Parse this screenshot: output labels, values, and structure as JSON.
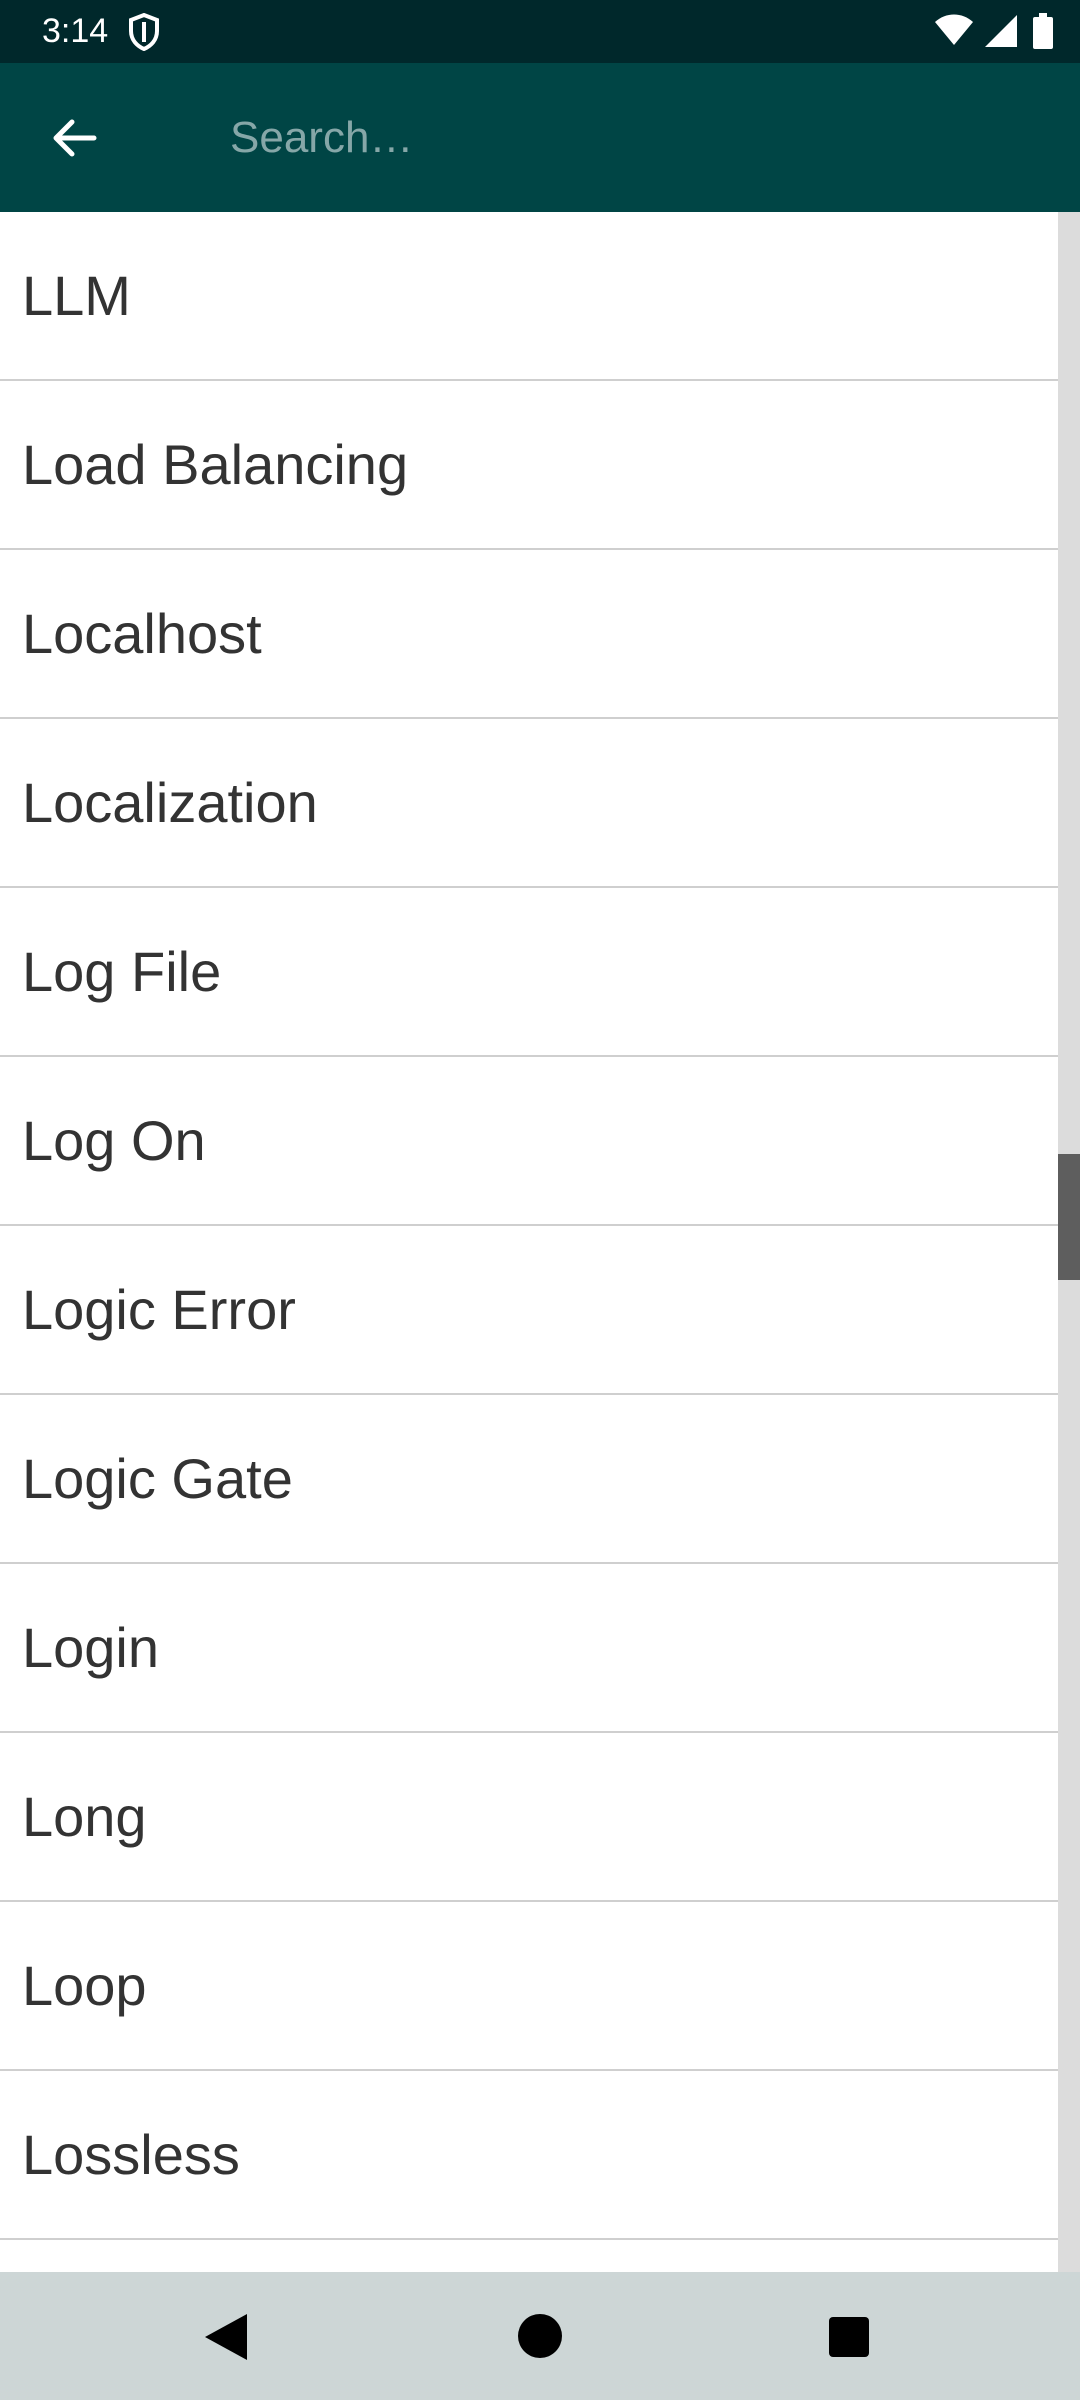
{
  "status_bar": {
    "time": "3:14",
    "icons": [
      "shield-icon",
      "wifi-icon",
      "signal-icon",
      "battery-icon"
    ]
  },
  "app_bar": {
    "back_icon": "arrow-left-icon",
    "search": {
      "placeholder": "Search…",
      "value": ""
    }
  },
  "list": {
    "items": [
      {
        "label": "LLM"
      },
      {
        "label": "Load Balancing"
      },
      {
        "label": "Localhost"
      },
      {
        "label": "Localization"
      },
      {
        "label": "Log File"
      },
      {
        "label": "Log On"
      },
      {
        "label": "Logic Error"
      },
      {
        "label": "Logic Gate"
      },
      {
        "label": "Login"
      },
      {
        "label": "Long"
      },
      {
        "label": "Loop"
      },
      {
        "label": "Lossless"
      },
      {
        "label": ""
      }
    ]
  },
  "nav_bar": {
    "icons": [
      "nav-back-icon",
      "nav-home-icon",
      "nav-recents-icon"
    ]
  },
  "colors": {
    "status_bar_bg": "#00282b",
    "app_bar_bg": "#004545",
    "placeholder": "#86a7a8",
    "item_text": "#333333",
    "divider": "#cfcfcf",
    "nav_bar_bg": "#cdd6d6"
  }
}
